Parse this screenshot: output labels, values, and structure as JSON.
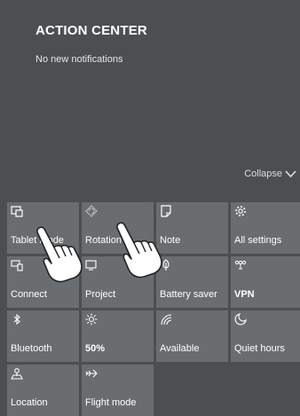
{
  "header": {
    "title": "ACTION CENTER",
    "empty_message": "No new notifications"
  },
  "collapse": {
    "label": "Collapse"
  },
  "tiles": [
    {
      "label": "Tablet mode",
      "icon": "tablet-mode-icon"
    },
    {
      "label": "Rotation",
      "icon": "rotation-lock-icon"
    },
    {
      "label": "Note",
      "icon": "note-icon"
    },
    {
      "label": "All settings",
      "icon": "gear-icon"
    },
    {
      "label": "Connect",
      "icon": "connect-icon"
    },
    {
      "label": "Project",
      "icon": "project-icon"
    },
    {
      "label": "Battery saver",
      "icon": "battery-saver-icon"
    },
    {
      "label": "VPN",
      "icon": "vpn-icon"
    },
    {
      "label": "Bluetooth",
      "icon": "bluetooth-icon"
    },
    {
      "label": "50%",
      "icon": "brightness-icon"
    },
    {
      "label": "Available",
      "icon": "wifi-icon"
    },
    {
      "label": "Quiet hours",
      "icon": "moon-icon"
    },
    {
      "label": "Location",
      "icon": "location-icon"
    },
    {
      "label": "Flight mode",
      "icon": "airplane-icon"
    }
  ]
}
